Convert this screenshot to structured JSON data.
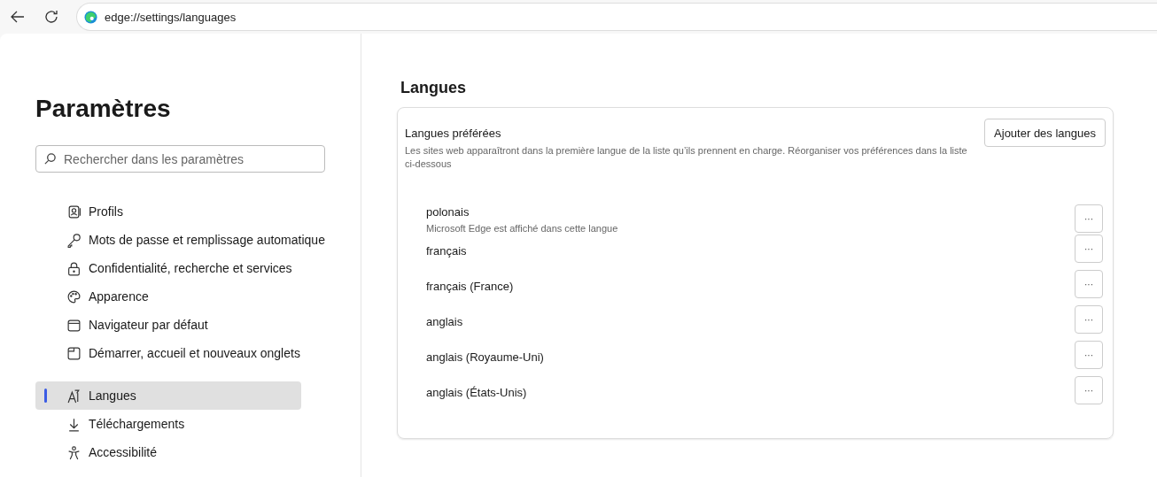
{
  "address_bar": {
    "url": "edge://settings/languages"
  },
  "sidebar": {
    "title": "Paramètres",
    "search": {
      "placeholder": "Rechercher dans les paramètres"
    },
    "sections": [
      {
        "items": [
          {
            "label": "Profils",
            "selected": false
          },
          {
            "label": "Mots de passe et remplissage automatique",
            "selected": false
          },
          {
            "label": "Confidentialité, recherche et services",
            "selected": false
          },
          {
            "label": "Apparence",
            "selected": false
          },
          {
            "label": "Navigateur par défaut",
            "selected": false
          },
          {
            "label": "Démarrer, accueil et nouveaux onglets",
            "selected": false
          }
        ]
      },
      {
        "items": [
          {
            "label": "Langues",
            "selected": true
          },
          {
            "label": "Téléchargements",
            "selected": false
          },
          {
            "label": "Accessibilité",
            "selected": false
          }
        ]
      }
    ]
  },
  "main": {
    "heading": "Langues",
    "card": {
      "title": "Langues préférées",
      "description": "Les sites web apparaîtront dans la première langue de la liste qu’ils prennent en charge. Réorganiser vos préférences dans la liste ci-dessous",
      "button": "Ajouter des langues",
      "languages": [
        {
          "name": "polonais",
          "note": "Microsoft Edge est affiché dans cette langue",
          "more": "···"
        },
        {
          "name": "français",
          "more": "···"
        },
        {
          "name": "français (France)",
          "more": "···"
        },
        {
          "name": "anglais",
          "more": "···"
        },
        {
          "name": "anglais (Royaume-Uni)",
          "more": "···"
        },
        {
          "name": "anglais (États-Unis)",
          "more": "···"
        }
      ]
    }
  }
}
